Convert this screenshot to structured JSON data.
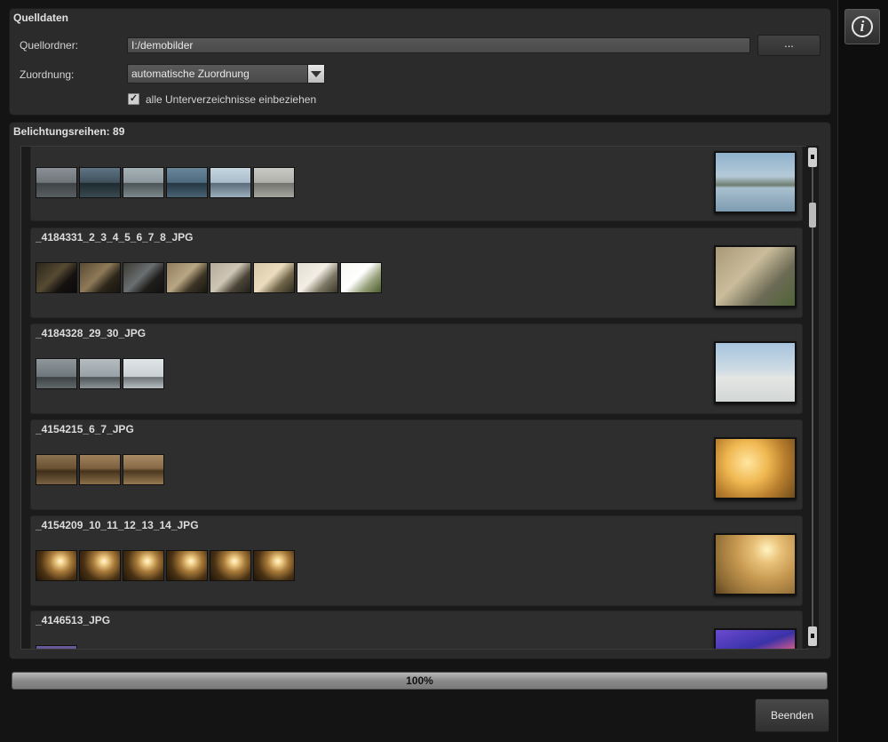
{
  "source_panel": {
    "title": "Quelldaten",
    "folder_label": "Quellordner:",
    "folder_value": "I:/demobilder",
    "browse_label": "...",
    "mapping_label": "Zuordnung:",
    "mapping_value": "automatische Zuordnung",
    "subdirs_checked": true,
    "subdirs_label": "alle Unterverzeichnisse einbeziehen",
    "check_glyph": "✓"
  },
  "series_panel": {
    "title": "Belichtungsreihen: 89",
    "cards": [
      {
        "name": "",
        "thumbs": [
          "t-mist-a",
          "t-mist-b",
          "t-mist-c",
          "t-mist-d",
          "t-mist-e",
          "t-mist-f"
        ],
        "preview": "p-mist"
      },
      {
        "name": "_4184331_2_3_4_5_6_7_8_JPG",
        "thumbs": [
          "t-dawn-1",
          "t-dawn-2",
          "t-dawn-3",
          "t-dawn-4",
          "t-dawn-5",
          "t-dawn-6",
          "t-dawn-7",
          "t-dawn-8"
        ],
        "preview": "p-dawn"
      },
      {
        "name": "_4184328_29_30_JPG",
        "thumbs": [
          "t-fog-1",
          "t-fog-2",
          "t-fog-3"
        ],
        "preview": "p-fog"
      },
      {
        "name": "_4154215_6_7_JPG",
        "thumbs": [
          "t-gold-1",
          "t-gold-2",
          "t-gold-3"
        ],
        "preview": "p-gold"
      },
      {
        "name": "_4154209_10_11_12_13_14_JPG",
        "thumbs": [
          "t-sun",
          "t-sun",
          "t-sun",
          "t-sun",
          "t-sun",
          "t-sun"
        ],
        "preview": "p-sun"
      },
      {
        "name": "_4146513_JPG",
        "thumbs": [
          "t-purple"
        ],
        "preview": "p-purple"
      }
    ]
  },
  "progress": {
    "value": 1.0,
    "label": "100%"
  },
  "buttons": {
    "finish_label": "Beenden"
  },
  "info_button": {
    "glyph": "i",
    "icon": "info-icon"
  }
}
